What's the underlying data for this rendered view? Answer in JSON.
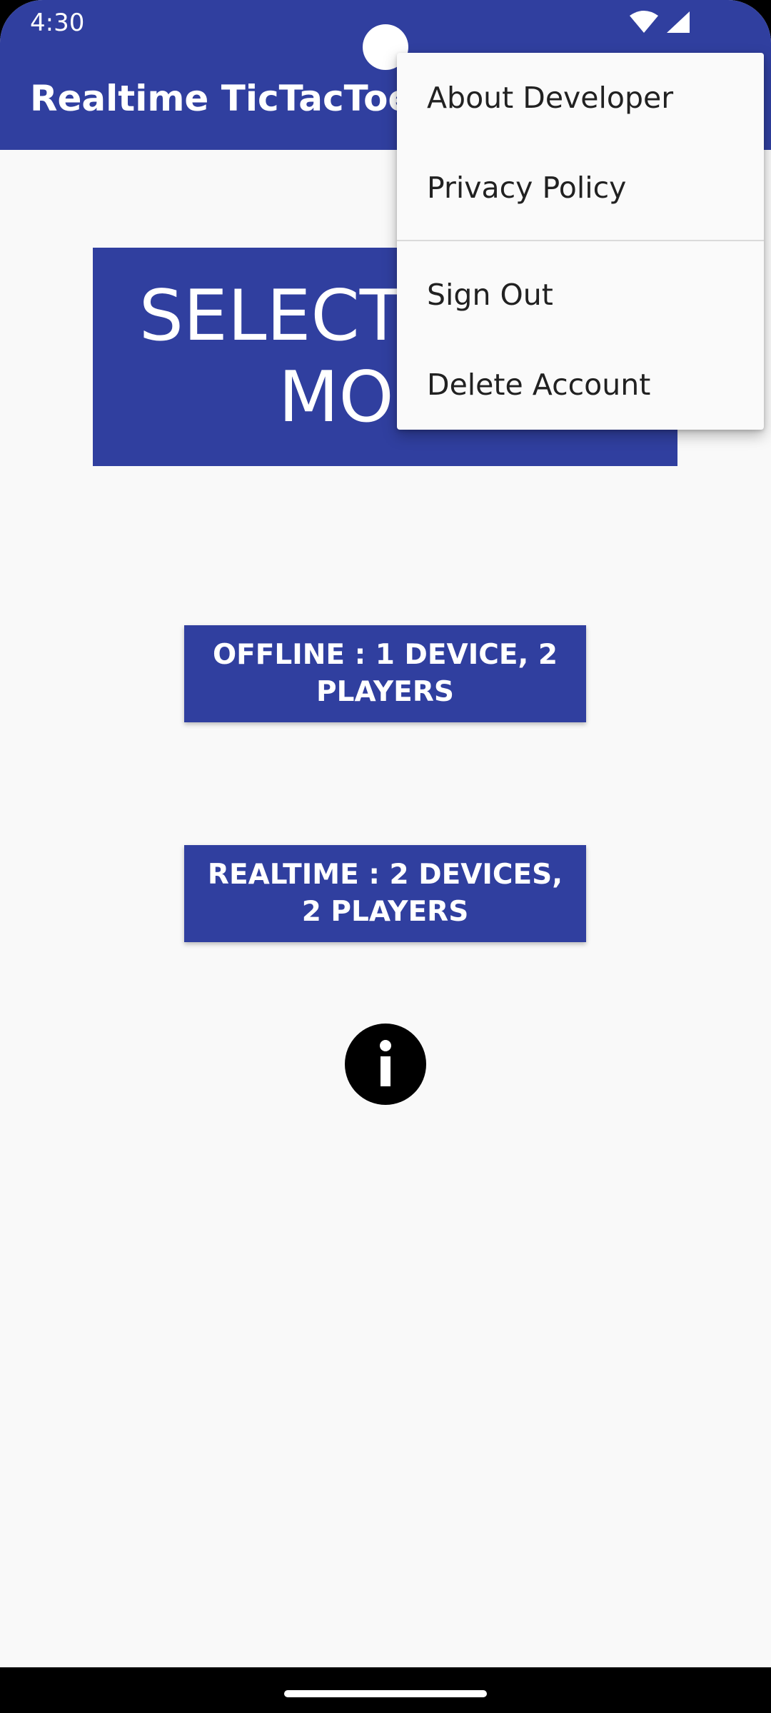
{
  "status_bar": {
    "time": "4:30",
    "icons": [
      "wifi-icon",
      "cell-signal-icon"
    ]
  },
  "app_bar": {
    "title": "Realtime TicTacToe"
  },
  "main": {
    "banner_text": "SELECT GAME MODE",
    "offline_button": "OFFLINE : 1 DEVICE, 2 PLAYERS",
    "realtime_button": "REALTIME : 2 DEVICES, 2 PLAYERS",
    "info_icon": "info-icon"
  },
  "overflow_menu": {
    "items": [
      {
        "label": "About Developer"
      },
      {
        "label": "Privacy Policy"
      },
      {
        "label": "Sign Out"
      },
      {
        "label": "Delete Account"
      }
    ]
  },
  "colors": {
    "primary": "#303f9f",
    "background": "#f9f9f9",
    "menu_background": "#fafafa",
    "menu_text": "#212121"
  }
}
